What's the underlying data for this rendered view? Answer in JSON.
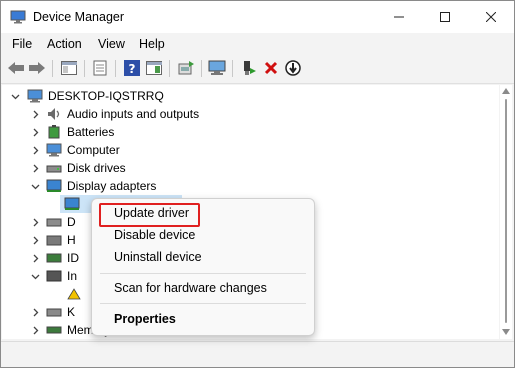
{
  "window": {
    "title": "Device Manager",
    "controls": [
      "minimize-icon",
      "maximize-icon",
      "close-icon"
    ]
  },
  "menu": {
    "items": [
      "File",
      "Action",
      "View",
      "Help"
    ]
  },
  "toolbar": {
    "buttons": [
      "back-icon",
      "forward-icon",
      "console-tree-icon",
      "properties-icon",
      "help-icon",
      "action-pane-icon",
      "update-driver-icon",
      "scan-hardware-icon",
      "enable-device-icon",
      "uninstall-icon",
      "disable-device-icon"
    ]
  },
  "tree": {
    "root": "DESKTOP-IQSTRRQ",
    "items": [
      {
        "label": "Audio inputs and outputs"
      },
      {
        "label": "Batteries"
      },
      {
        "label": "Computer"
      },
      {
        "label": "Disk drives"
      },
      {
        "label": "Display adapters",
        "expanded": true
      }
    ],
    "partial_labels": [
      "D",
      "H",
      "ID",
      "In",
      "K",
      "Memory devices"
    ]
  },
  "context_menu": {
    "items": [
      {
        "label": "Update driver",
        "highlighted": true
      },
      {
        "label": "Disable device"
      },
      {
        "label": "Uninstall device"
      },
      {
        "label": "Scan for hardware changes"
      },
      {
        "label": "Properties",
        "bold": true
      }
    ],
    "highlight_color": "#e02020"
  }
}
